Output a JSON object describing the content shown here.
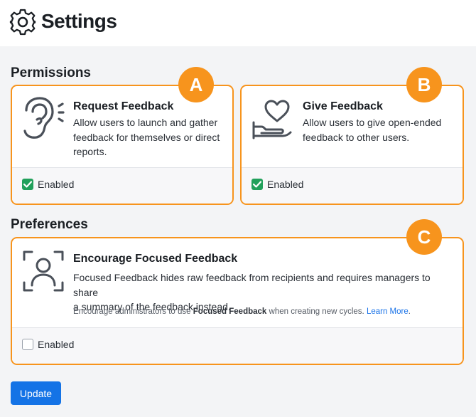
{
  "page": {
    "title": "Settings",
    "icon": "gear-icon"
  },
  "permissions": {
    "heading": "Permissions",
    "cards": [
      {
        "badge": "A",
        "icon": "ear-icon",
        "title": "Request Feedback",
        "description_lines": [
          "Allow users to launch and gather",
          "feedback for themselves or direct",
          "reports."
        ],
        "enabled_label": "Enabled",
        "enabled": true
      },
      {
        "badge": "B",
        "icon": "hand-heart-icon",
        "title": "Give Feedback",
        "description_lines": [
          "Allow users to give open-ended",
          "feedback to other users."
        ],
        "enabled_label": "Enabled",
        "enabled": true
      }
    ]
  },
  "preferences": {
    "heading": "Preferences",
    "card": {
      "badge": "C",
      "icon": "person-frame-icon",
      "title": "Encourage Focused Feedback",
      "description_lines": [
        "Focused Feedback hides raw feedback from recipients and requires managers to share",
        "a summary of the feedback instead."
      ],
      "note_prefix": "Encourage administrators to use ",
      "note_bold": "Focused Feedback",
      "note_suffix": " when creating new cycles. ",
      "note_link": "Learn More",
      "note_end": ".",
      "enabled_label": "Enabled",
      "enabled": false
    }
  },
  "update_button": "Update",
  "colors": {
    "accent_orange": "#f7941d",
    "check_green": "#21a05b",
    "button_blue": "#1473e6",
    "link_blue": "#1a73e8"
  }
}
